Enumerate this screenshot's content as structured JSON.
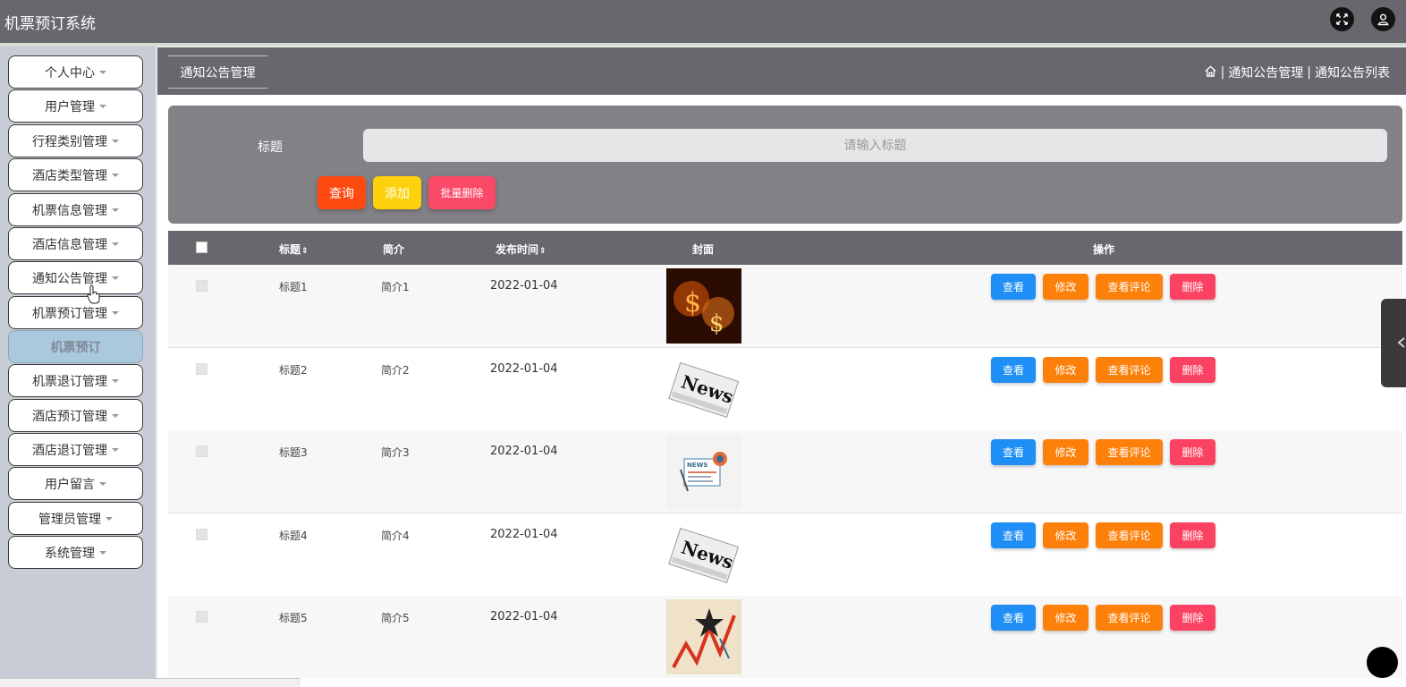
{
  "app": {
    "title": "机票预订系统"
  },
  "topbar": {
    "icons": [
      "fullscreen-icon",
      "user-icon"
    ]
  },
  "sidebar": {
    "items": [
      {
        "label": "个人中心",
        "caret": true
      },
      {
        "label": "用户管理",
        "caret": true
      },
      {
        "label": "行程类别管理",
        "caret": true
      },
      {
        "label": "酒店类型管理",
        "caret": true
      },
      {
        "label": "机票信息管理",
        "caret": true
      },
      {
        "label": "酒店信息管理",
        "caret": true
      },
      {
        "label": "通知公告管理",
        "caret": true
      },
      {
        "label": "机票预订管理",
        "caret": true
      },
      {
        "label": "机票预订",
        "caret": false,
        "active": true
      },
      {
        "label": "机票退订管理",
        "caret": true
      },
      {
        "label": "酒店预订管理",
        "caret": true
      },
      {
        "label": "酒店退订管理",
        "caret": true
      },
      {
        "label": "用户留言",
        "caret": true
      },
      {
        "label": "管理员管理",
        "caret": true
      },
      {
        "label": "系统管理",
        "caret": true
      }
    ]
  },
  "page": {
    "tab": "通知公告管理",
    "breadcrumb": {
      "sep1": " | ",
      "section": "通知公告管理",
      "sep2": " | ",
      "current": "通知公告列表"
    }
  },
  "search": {
    "label": "标题",
    "placeholder": "请输入标题",
    "value": "",
    "query_btn": "查询",
    "add_btn": "添加",
    "batch_delete_btn": "批量删除"
  },
  "table": {
    "headers": {
      "title": "标题",
      "summary": "简介",
      "publish_time": "发布时间",
      "cover": "封面",
      "actions": "操作",
      "sort_icon": "⇕"
    },
    "action_labels": {
      "view": "查看",
      "edit": "修改",
      "comments": "查看评论",
      "delete": "删除"
    },
    "rows": [
      {
        "title": "标题1",
        "summary": "简介1",
        "date": "2022-01-04",
        "cover": "money-cover"
      },
      {
        "title": "标题2",
        "summary": "简介2",
        "date": "2022-01-04",
        "cover": "news-cover"
      },
      {
        "title": "标题3",
        "summary": "简介3",
        "date": "2022-01-04",
        "cover": "news-illustration-cover"
      },
      {
        "title": "标题4",
        "summary": "简介4",
        "date": "2022-01-04",
        "cover": "news-cover"
      },
      {
        "title": "标题5",
        "summary": "简介5",
        "date": "2022-01-04",
        "cover": "chart-cover"
      }
    ]
  },
  "cover_text": {
    "news": "News",
    "news_small": "NEWS",
    "money": "$"
  },
  "colors": {
    "header": "#68676d",
    "query": "#fd4a11",
    "add": "#fdd20c",
    "batch_delete": "#fb4a67",
    "view": "#1f8ff5",
    "edit": "#fd800b",
    "delete": "#fb4262"
  }
}
